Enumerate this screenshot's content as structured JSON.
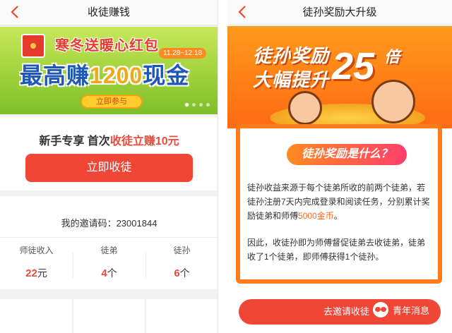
{
  "left": {
    "title": "收徒赚钱",
    "banner": {
      "line1": "寒冬送暖心红包",
      "date_range": "11.28~12.18",
      "line2_prefix": "最高赚",
      "line2_amount": "1200",
      "line2_suffix": "现金",
      "join_label": "立即参与"
    },
    "promo": {
      "prefix": "新手专享 首次",
      "highlight": "收徒立赚10元"
    },
    "cta_label": "立即收徒",
    "invite_label": "我的邀请码：",
    "invite_code": "23001844",
    "stats": [
      {
        "label": "师徒收入",
        "value": "22",
        "unit": "元"
      },
      {
        "label": "徒弟",
        "value": "4",
        "unit": "个"
      },
      {
        "label": "徒孙",
        "value": "6",
        "unit": "个"
      }
    ]
  },
  "right": {
    "title": "徒孙奖励大升级",
    "hero": {
      "line1": "徒孙奖励",
      "line2": "大幅提升",
      "number": "25",
      "unit": "倍"
    },
    "card_title": "徒孙奖励是什么？",
    "para1_a": "徒孙收益来源于每个徒弟所收的前两个徒弟，若徒孙注册7天内完成登录和阅读任务，分别累计奖励徒弟和师傅",
    "para1_highlight": "5000金币",
    "para1_b": "。",
    "para2": "因此，收徒孙即为师傅督促徒弟去收徒弟，徒弟收了1个徒弟，即师傅获得1个徒孙。",
    "button_label": "去邀请收徒",
    "watermark": "青年消息"
  },
  "colors": {
    "accent_red": "#ef4636",
    "orange": "#ff7b1c",
    "blue": "#1f57b6",
    "green": "#9fd23c"
  }
}
